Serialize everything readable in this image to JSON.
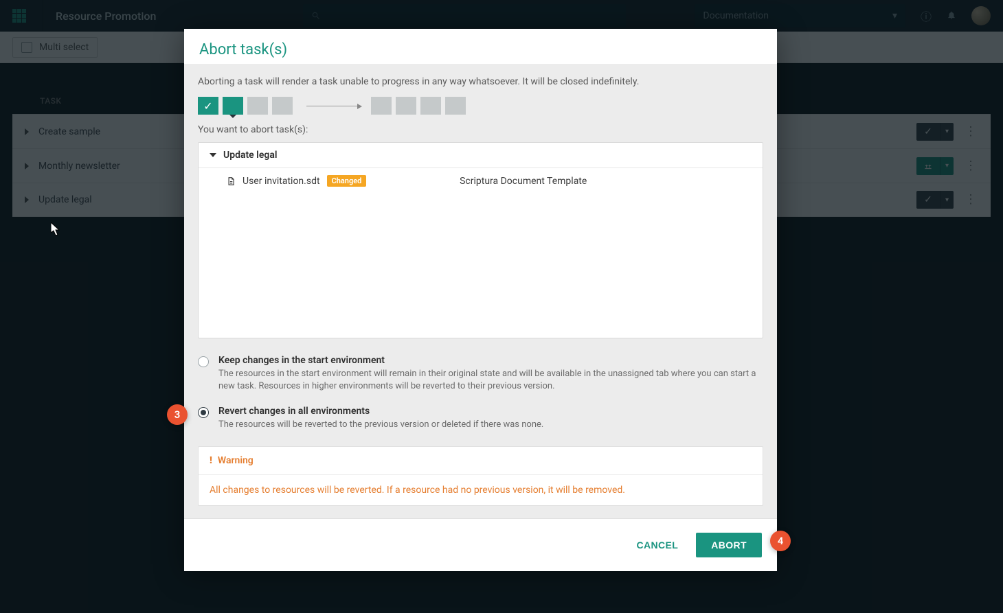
{
  "header": {
    "title": "Resource Promotion",
    "docs_label": "Documentation"
  },
  "subbar": {
    "multi_select": "Multi select"
  },
  "tasklist": {
    "header_task": "TASK",
    "rows": [
      {
        "label": "Create sample"
      },
      {
        "label": "Monthly newsletter"
      },
      {
        "label": "Update legal"
      }
    ]
  },
  "modal": {
    "title": "Abort task(s)",
    "description": "Aborting a task will render a task unable to progress in any way whatsoever. It will be closed indefinitely.",
    "sub": "You want to abort task(s):",
    "task_group": "Update legal",
    "file": {
      "name": "User invitation.sdt",
      "badge": "Changed",
      "type": "Scriptura Document Template"
    },
    "opt1": {
      "title": "Keep changes in the start environment",
      "desc": "The resources in the start environment will remain in their original state and will be available in the unassigned tab where you can start a new task. Resources in higher environments will be reverted to their previous version."
    },
    "opt2": {
      "title": "Revert changes in all environments",
      "desc": "The resources will be reverted to the previous version or deleted if there was none."
    },
    "warning": {
      "label": "Warning",
      "body": "All changes to resources will be reverted. If a resource had no previous version, it will be removed."
    },
    "cancel": "CANCEL",
    "abort": "ABORT"
  },
  "annotations": {
    "a3": "3",
    "a4": "4"
  }
}
